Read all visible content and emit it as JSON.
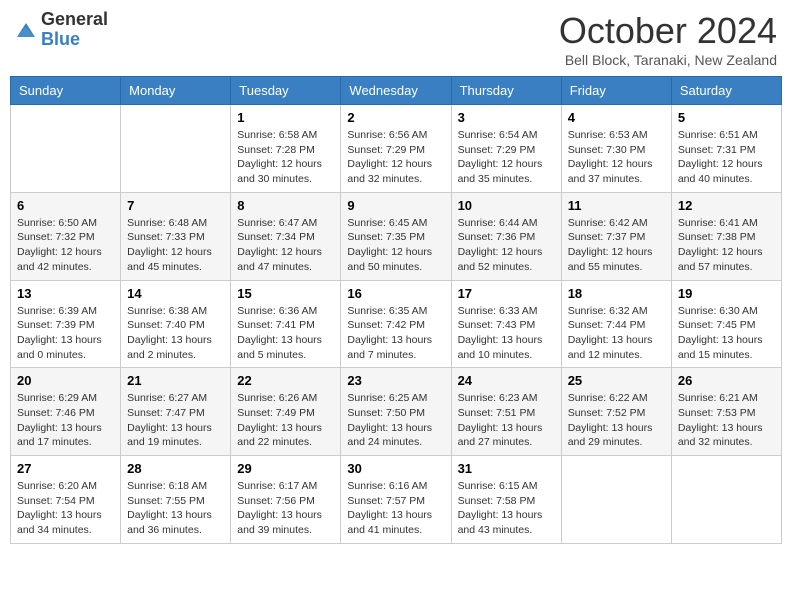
{
  "logo": {
    "general": "General",
    "blue": "Blue"
  },
  "title": "October 2024",
  "location": "Bell Block, Taranaki, New Zealand",
  "days_of_week": [
    "Sunday",
    "Monday",
    "Tuesday",
    "Wednesday",
    "Thursday",
    "Friday",
    "Saturday"
  ],
  "weeks": [
    [
      {
        "day": "",
        "info": ""
      },
      {
        "day": "",
        "info": ""
      },
      {
        "day": "1",
        "info": "Sunrise: 6:58 AM\nSunset: 7:28 PM\nDaylight: 12 hours and 30 minutes."
      },
      {
        "day": "2",
        "info": "Sunrise: 6:56 AM\nSunset: 7:29 PM\nDaylight: 12 hours and 32 minutes."
      },
      {
        "day": "3",
        "info": "Sunrise: 6:54 AM\nSunset: 7:29 PM\nDaylight: 12 hours and 35 minutes."
      },
      {
        "day": "4",
        "info": "Sunrise: 6:53 AM\nSunset: 7:30 PM\nDaylight: 12 hours and 37 minutes."
      },
      {
        "day": "5",
        "info": "Sunrise: 6:51 AM\nSunset: 7:31 PM\nDaylight: 12 hours and 40 minutes."
      }
    ],
    [
      {
        "day": "6",
        "info": "Sunrise: 6:50 AM\nSunset: 7:32 PM\nDaylight: 12 hours and 42 minutes."
      },
      {
        "day": "7",
        "info": "Sunrise: 6:48 AM\nSunset: 7:33 PM\nDaylight: 12 hours and 45 minutes."
      },
      {
        "day": "8",
        "info": "Sunrise: 6:47 AM\nSunset: 7:34 PM\nDaylight: 12 hours and 47 minutes."
      },
      {
        "day": "9",
        "info": "Sunrise: 6:45 AM\nSunset: 7:35 PM\nDaylight: 12 hours and 50 minutes."
      },
      {
        "day": "10",
        "info": "Sunrise: 6:44 AM\nSunset: 7:36 PM\nDaylight: 12 hours and 52 minutes."
      },
      {
        "day": "11",
        "info": "Sunrise: 6:42 AM\nSunset: 7:37 PM\nDaylight: 12 hours and 55 minutes."
      },
      {
        "day": "12",
        "info": "Sunrise: 6:41 AM\nSunset: 7:38 PM\nDaylight: 12 hours and 57 minutes."
      }
    ],
    [
      {
        "day": "13",
        "info": "Sunrise: 6:39 AM\nSunset: 7:39 PM\nDaylight: 13 hours and 0 minutes."
      },
      {
        "day": "14",
        "info": "Sunrise: 6:38 AM\nSunset: 7:40 PM\nDaylight: 13 hours and 2 minutes."
      },
      {
        "day": "15",
        "info": "Sunrise: 6:36 AM\nSunset: 7:41 PM\nDaylight: 13 hours and 5 minutes."
      },
      {
        "day": "16",
        "info": "Sunrise: 6:35 AM\nSunset: 7:42 PM\nDaylight: 13 hours and 7 minutes."
      },
      {
        "day": "17",
        "info": "Sunrise: 6:33 AM\nSunset: 7:43 PM\nDaylight: 13 hours and 10 minutes."
      },
      {
        "day": "18",
        "info": "Sunrise: 6:32 AM\nSunset: 7:44 PM\nDaylight: 13 hours and 12 minutes."
      },
      {
        "day": "19",
        "info": "Sunrise: 6:30 AM\nSunset: 7:45 PM\nDaylight: 13 hours and 15 minutes."
      }
    ],
    [
      {
        "day": "20",
        "info": "Sunrise: 6:29 AM\nSunset: 7:46 PM\nDaylight: 13 hours and 17 minutes."
      },
      {
        "day": "21",
        "info": "Sunrise: 6:27 AM\nSunset: 7:47 PM\nDaylight: 13 hours and 19 minutes."
      },
      {
        "day": "22",
        "info": "Sunrise: 6:26 AM\nSunset: 7:49 PM\nDaylight: 13 hours and 22 minutes."
      },
      {
        "day": "23",
        "info": "Sunrise: 6:25 AM\nSunset: 7:50 PM\nDaylight: 13 hours and 24 minutes."
      },
      {
        "day": "24",
        "info": "Sunrise: 6:23 AM\nSunset: 7:51 PM\nDaylight: 13 hours and 27 minutes."
      },
      {
        "day": "25",
        "info": "Sunrise: 6:22 AM\nSunset: 7:52 PM\nDaylight: 13 hours and 29 minutes."
      },
      {
        "day": "26",
        "info": "Sunrise: 6:21 AM\nSunset: 7:53 PM\nDaylight: 13 hours and 32 minutes."
      }
    ],
    [
      {
        "day": "27",
        "info": "Sunrise: 6:20 AM\nSunset: 7:54 PM\nDaylight: 13 hours and 34 minutes."
      },
      {
        "day": "28",
        "info": "Sunrise: 6:18 AM\nSunset: 7:55 PM\nDaylight: 13 hours and 36 minutes."
      },
      {
        "day": "29",
        "info": "Sunrise: 6:17 AM\nSunset: 7:56 PM\nDaylight: 13 hours and 39 minutes."
      },
      {
        "day": "30",
        "info": "Sunrise: 6:16 AM\nSunset: 7:57 PM\nDaylight: 13 hours and 41 minutes."
      },
      {
        "day": "31",
        "info": "Sunrise: 6:15 AM\nSunset: 7:58 PM\nDaylight: 13 hours and 43 minutes."
      },
      {
        "day": "",
        "info": ""
      },
      {
        "day": "",
        "info": ""
      }
    ]
  ]
}
